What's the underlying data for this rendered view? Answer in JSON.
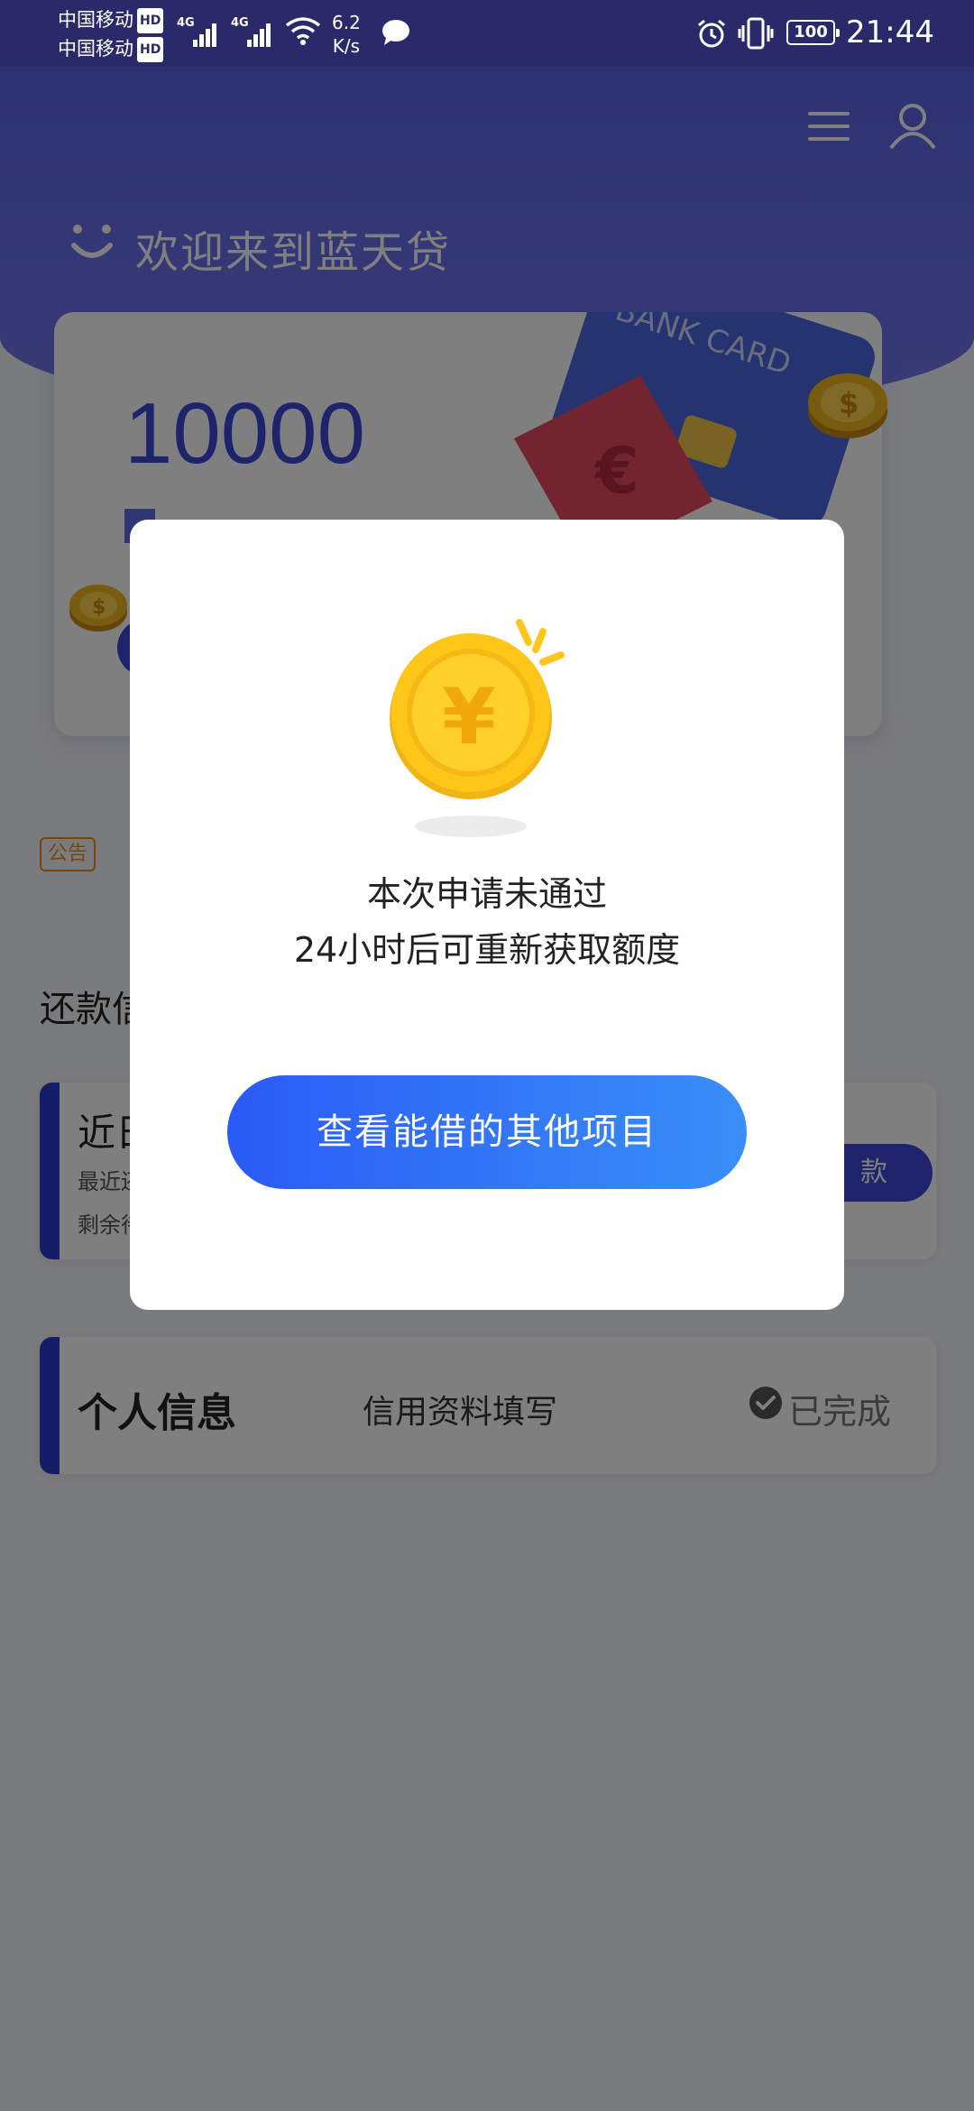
{
  "status_bar": {
    "carrier1": "中国移动",
    "carrier2": "中国移动",
    "hd": "HD",
    "net1": "4G",
    "net2": "4G",
    "speed_value": "6.2",
    "speed_unit": "K/s",
    "battery": "100",
    "time": "21:44"
  },
  "header": {
    "welcome": "欢迎来到蓝天贷",
    "menu_icon": "menu-icon",
    "user_icon": "user-icon"
  },
  "card": {
    "amount": "10000",
    "bank_card_text": "BANK CARD"
  },
  "notice": {
    "badge": "公告"
  },
  "section": {
    "title": "还款信"
  },
  "repay": {
    "title": "近日",
    "line1": "最近还",
    "line2": "剩余待",
    "button": "款"
  },
  "info": {
    "title": "个人信息",
    "subtitle": "信用资料填写",
    "status": "已完成"
  },
  "modal": {
    "message_line1": "本次申请未通过",
    "message_line2": "24小时后可重新获取额度",
    "button": "查看能借的其他项目"
  },
  "colors": {
    "header": "#5d63e6",
    "accent": "#3e46d6",
    "button_gradient_start": "#2a5bf5",
    "button_gradient_end": "#3a8ff8",
    "notice": "#f08a1c"
  }
}
